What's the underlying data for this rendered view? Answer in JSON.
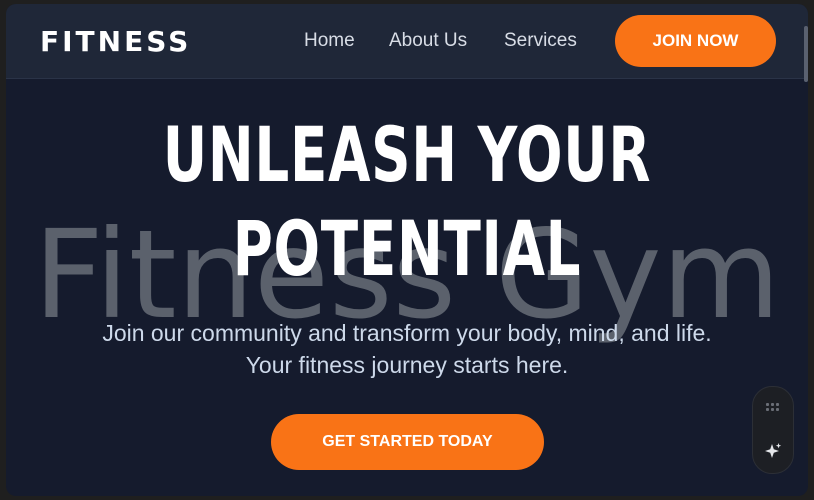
{
  "nav": {
    "logo": "FITNESS",
    "links": [
      "Home",
      "About Us",
      "Services"
    ],
    "join_label": "JOIN NOW"
  },
  "hero": {
    "watermark": "Fitness Gym",
    "headline_line1": "UNLEASH YOUR",
    "headline_line2": "POTENTIAL",
    "tagline_line1": "Join our community and transform your body, mind, and life.",
    "tagline_line2": "Your fitness journey starts here.",
    "cta_label": "GET STARTED TODAY"
  },
  "widget": {
    "icons": [
      "grid-icon",
      "sparkle-icon"
    ]
  },
  "colors": {
    "accent": "#f97316",
    "background": "#151b2d",
    "navbar": "#1f2738"
  }
}
